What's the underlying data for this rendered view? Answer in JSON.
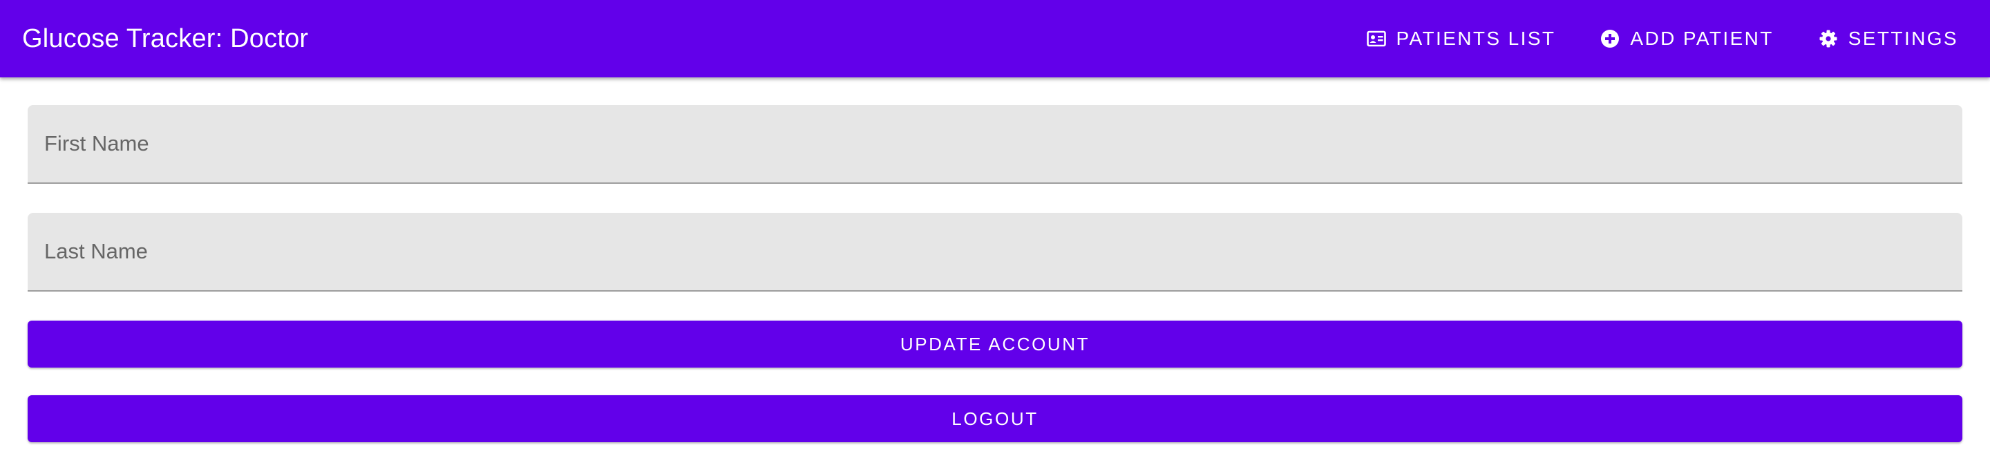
{
  "app": {
    "title": "Glucose Tracker: Doctor",
    "accent_color": "#6200ea"
  },
  "nav": [
    {
      "label": "PATIENTS LIST",
      "icon": "id-card-icon"
    },
    {
      "label": "ADD PATIENT",
      "icon": "add-circle-icon"
    },
    {
      "label": "SETTINGS",
      "icon": "gear-icon"
    }
  ],
  "form": {
    "first_name": {
      "placeholder": "First Name",
      "value": ""
    },
    "last_name": {
      "placeholder": "Last Name",
      "value": ""
    },
    "update_label": "UPDATE ACCOUNT",
    "logout_label": "LOGOUT"
  }
}
